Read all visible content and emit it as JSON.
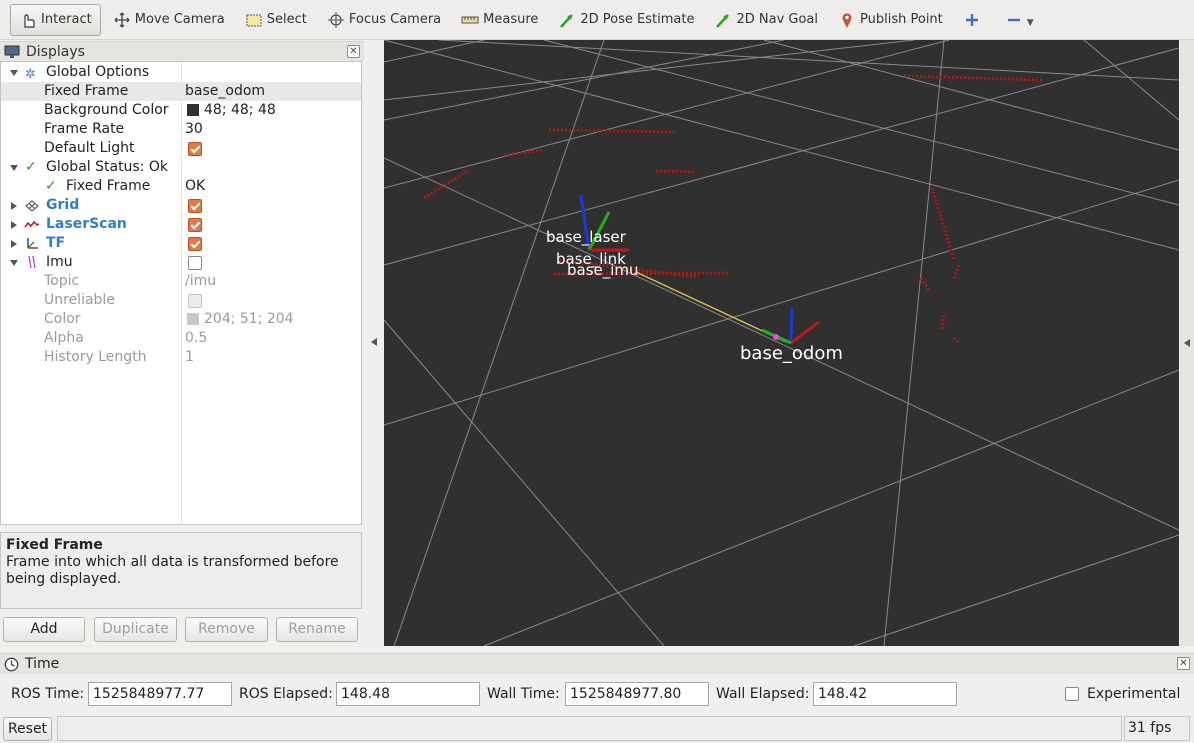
{
  "toolbar": {
    "items": [
      {
        "label": "Interact",
        "icon": "hand-pointer-icon",
        "active": true
      },
      {
        "label": "Move Camera",
        "icon": "move-camera-icon"
      },
      {
        "label": "Select",
        "icon": "select-rectangle-icon"
      },
      {
        "label": "Focus Camera",
        "icon": "focus-target-icon"
      },
      {
        "label": "Measure",
        "icon": "ruler-icon"
      },
      {
        "label": "2D Pose Estimate",
        "icon": "green-arrow-icon"
      },
      {
        "label": "2D Nav Goal",
        "icon": "green-arrow-icon"
      },
      {
        "label": "Publish Point",
        "icon": "map-pin-icon"
      }
    ]
  },
  "displays": {
    "title": "Displays",
    "rows": [
      {
        "label": "Global Options",
        "value": ""
      },
      {
        "label": "Fixed Frame",
        "value": "base_odom"
      },
      {
        "label": "Background Color",
        "value": "48; 48; 48"
      },
      {
        "label": "Frame Rate",
        "value": "30"
      },
      {
        "label": "Default Light",
        "value": ""
      },
      {
        "label": "Global Status: Ok",
        "value": ""
      },
      {
        "label": "Fixed Frame",
        "value": "OK"
      },
      {
        "label": "Grid",
        "value": ""
      },
      {
        "label": "LaserScan",
        "value": ""
      },
      {
        "label": "TF",
        "value": ""
      },
      {
        "label": "Imu",
        "value": ""
      },
      {
        "label": "Topic",
        "value": "/imu"
      },
      {
        "label": "Unreliable",
        "value": ""
      },
      {
        "label": "Color",
        "value": "204; 51; 204"
      },
      {
        "label": "Alpha",
        "value": "0.5"
      },
      {
        "label": "History Length",
        "value": "1"
      }
    ],
    "description_title": "Fixed Frame",
    "description_text": "Frame into which all data is transformed before being displayed.",
    "buttons": {
      "add": "Add",
      "duplicate": "Duplicate",
      "remove": "Remove",
      "rename": "Rename"
    }
  },
  "viewport": {
    "background_color": "#303030",
    "frame_labels": [
      "base_laser",
      "base_link",
      "base_imu",
      "base_odom"
    ]
  },
  "time": {
    "title": "Time",
    "ros_time_label": "ROS Time:",
    "ros_time": "1525848977.77",
    "ros_elapsed_label": "ROS Elapsed:",
    "ros_elapsed": "148.48",
    "wall_time_label": "Wall Time:",
    "wall_time": "1525848977.80",
    "wall_elapsed_label": "Wall Elapsed:",
    "wall_elapsed": "148.42",
    "experimental_label": "Experimental"
  },
  "status": {
    "reset_label": "Reset",
    "fps": "31 fps"
  }
}
